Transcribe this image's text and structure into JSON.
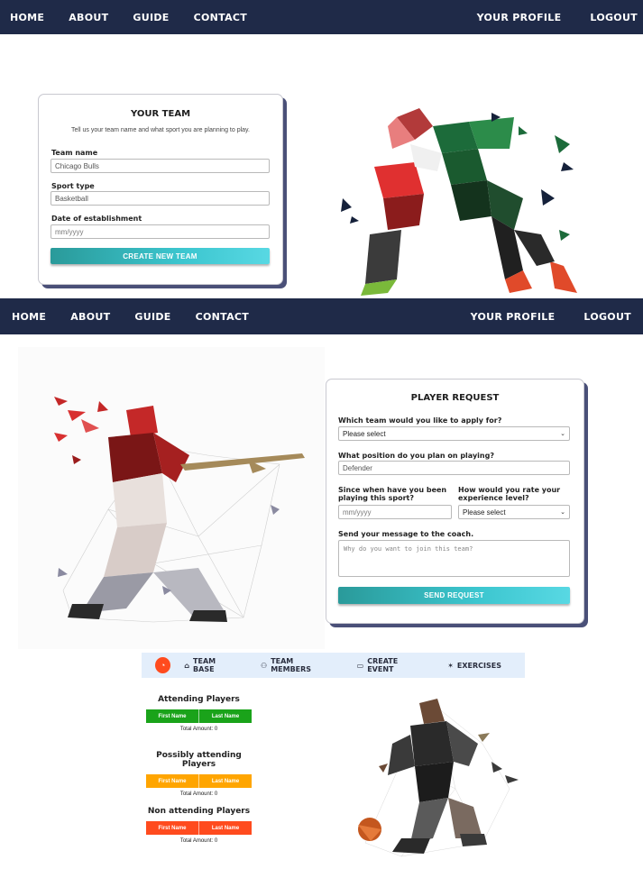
{
  "nav": {
    "home": "HOME",
    "about": "ABOUT",
    "guide": "GUIDE",
    "contact": "CONTACT",
    "profile": "YOUR PROFILE",
    "logout": "LOGOUT"
  },
  "team_form": {
    "title": "YOUR TEAM",
    "subtitle": "Tell us your team name and what sport you are planning to play.",
    "team_name_label": "Team name",
    "team_name_value": "Chicago Bulls",
    "sport_label": "Sport type",
    "sport_value": "Basketball",
    "date_label": "Date of establishment",
    "date_placeholder": "mm/yyyy",
    "submit": "CREATE NEW TEAM"
  },
  "player_form": {
    "title": "PLAYER REQUEST",
    "team_label": "Which team would you like to apply for?",
    "team_value": "Please select",
    "position_label": "What position do you plan on playing?",
    "position_value": "Defender",
    "since_label": "Since when have you been playing this sport?",
    "since_placeholder": "mm/yyyy",
    "experience_label": "How would you rate your experience level?",
    "experience_value": "Please select",
    "message_label": "Send your message to the coach.",
    "message_placeholder": "Why do you want to join this team?",
    "submit": "SEND REQUEST"
  },
  "team_nav": {
    "team_base": "TEAM BASE",
    "team_members": "TEAM MEMBERS",
    "create_event": "CREATE EVENT",
    "exercises": "EXERCISES"
  },
  "attendance": [
    {
      "title": "Attending Players",
      "first": "First Name",
      "last": "Last Name",
      "total": "Total Amount: 0",
      "color": "#1aa31a"
    },
    {
      "title": "Possibly attending Players",
      "first": "First Name",
      "last": "Last Name",
      "total": "Total Amount: 0",
      "color": "#ffa500"
    },
    {
      "title": "Non attending Players",
      "first": "First Name",
      "last": "Last Name",
      "total": "Total Amount: 0",
      "color": "#ff4b1e"
    }
  ],
  "colors": {
    "navbar": "#1f2a48",
    "accent_teal": "#3cc6cf",
    "tabbar": "#e3eefb",
    "logo": "#ff4b1e"
  }
}
